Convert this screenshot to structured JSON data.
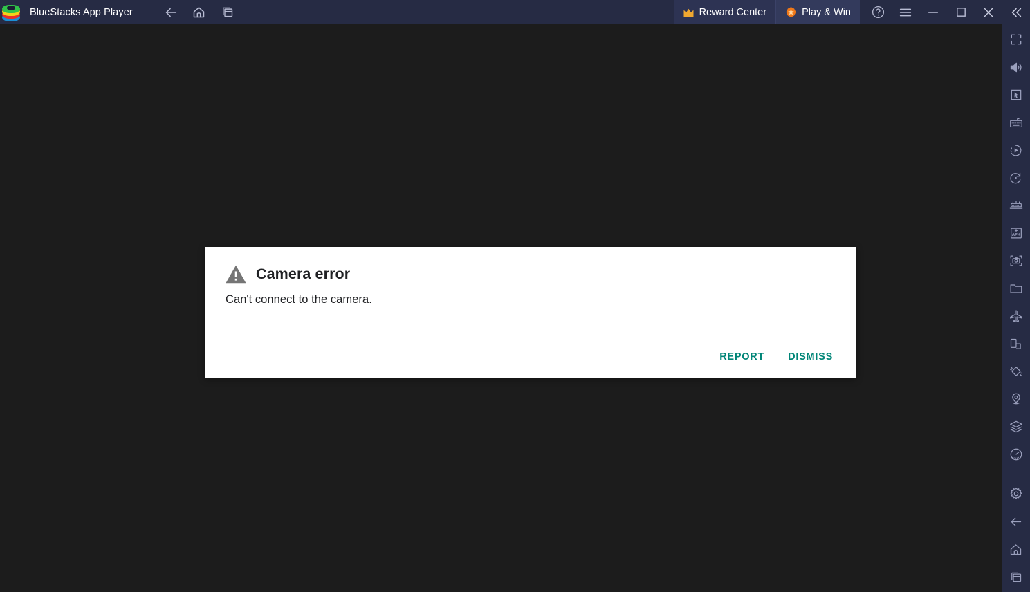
{
  "window": {
    "title": "BlueStacks App Player",
    "logo_icon": "bluestacks-logo"
  },
  "titlebar": {
    "nav": [
      {
        "name": "back-icon",
        "label": "Back"
      },
      {
        "name": "home-icon",
        "label": "Home"
      },
      {
        "name": "recent-apps-icon",
        "label": "Recent apps"
      }
    ],
    "promos": [
      {
        "name": "reward-center",
        "label": "Reward Center",
        "icon": "crown-icon",
        "icon_color": "#f0a830"
      },
      {
        "name": "play-and-win",
        "label": "Play & Win",
        "icon": "star-badge-icon",
        "icon_color": "#f07818"
      }
    ],
    "system": [
      {
        "name": "help-icon",
        "label": "Help"
      },
      {
        "name": "hamburger-menu-icon",
        "label": "Menu"
      },
      {
        "name": "minimize-icon",
        "label": "Minimize"
      },
      {
        "name": "maximize-icon",
        "label": "Maximize"
      },
      {
        "name": "close-icon",
        "label": "Close"
      },
      {
        "name": "collapse-sidebar-icon",
        "label": "Collapse"
      }
    ]
  },
  "dialog": {
    "icon": "warning-triangle-icon",
    "title": "Camera error",
    "message": "Can't connect to the camera.",
    "buttons": [
      {
        "name": "report-button",
        "label": "REPORT"
      },
      {
        "name": "dismiss-button",
        "label": "DISMISS"
      }
    ],
    "button_color": "#008577"
  },
  "sidebar": {
    "items": [
      {
        "name": "fullscreen-icon",
        "label": "Full screen"
      },
      {
        "name": "volume-icon",
        "label": "Volume"
      },
      {
        "name": "cursor-pointer-icon",
        "label": "Controls"
      },
      {
        "name": "keyboard-icon",
        "label": "Game controls"
      },
      {
        "name": "macro-recorder-icon",
        "label": "Macro recorder"
      },
      {
        "name": "rotate-icon",
        "label": "Rotate"
      },
      {
        "name": "gamepad-icon",
        "label": "Gamepad"
      },
      {
        "name": "install-apk-icon",
        "label": "Install APK"
      },
      {
        "name": "screenshot-icon",
        "label": "Screenshot"
      },
      {
        "name": "media-folder-icon",
        "label": "Media manager"
      },
      {
        "name": "eco-mode-icon",
        "label": "Eco mode"
      },
      {
        "name": "multi-instance-icon",
        "label": "Multi-instance"
      },
      {
        "name": "shake-icon",
        "label": "Shake"
      },
      {
        "name": "location-pin-icon",
        "label": "Location"
      },
      {
        "name": "layers-icon",
        "label": "Instance manager"
      },
      {
        "name": "performance-meter-icon",
        "label": "Performance"
      },
      {
        "name": "settings-gear-icon",
        "label": "Settings"
      },
      {
        "name": "back-arrow-icon",
        "label": "Back"
      },
      {
        "name": "home-nav-icon",
        "label": "Home"
      },
      {
        "name": "recents-nav-icon",
        "label": "Recent apps"
      }
    ]
  },
  "colors": {
    "titlebar_bg": "#262b44",
    "content_bg": "#1c1c1c",
    "sidebar_bg": "#262b44",
    "dialog_bg": "#ffffff",
    "accent_teal": "#008577",
    "accent_orange": "#f0a830"
  }
}
